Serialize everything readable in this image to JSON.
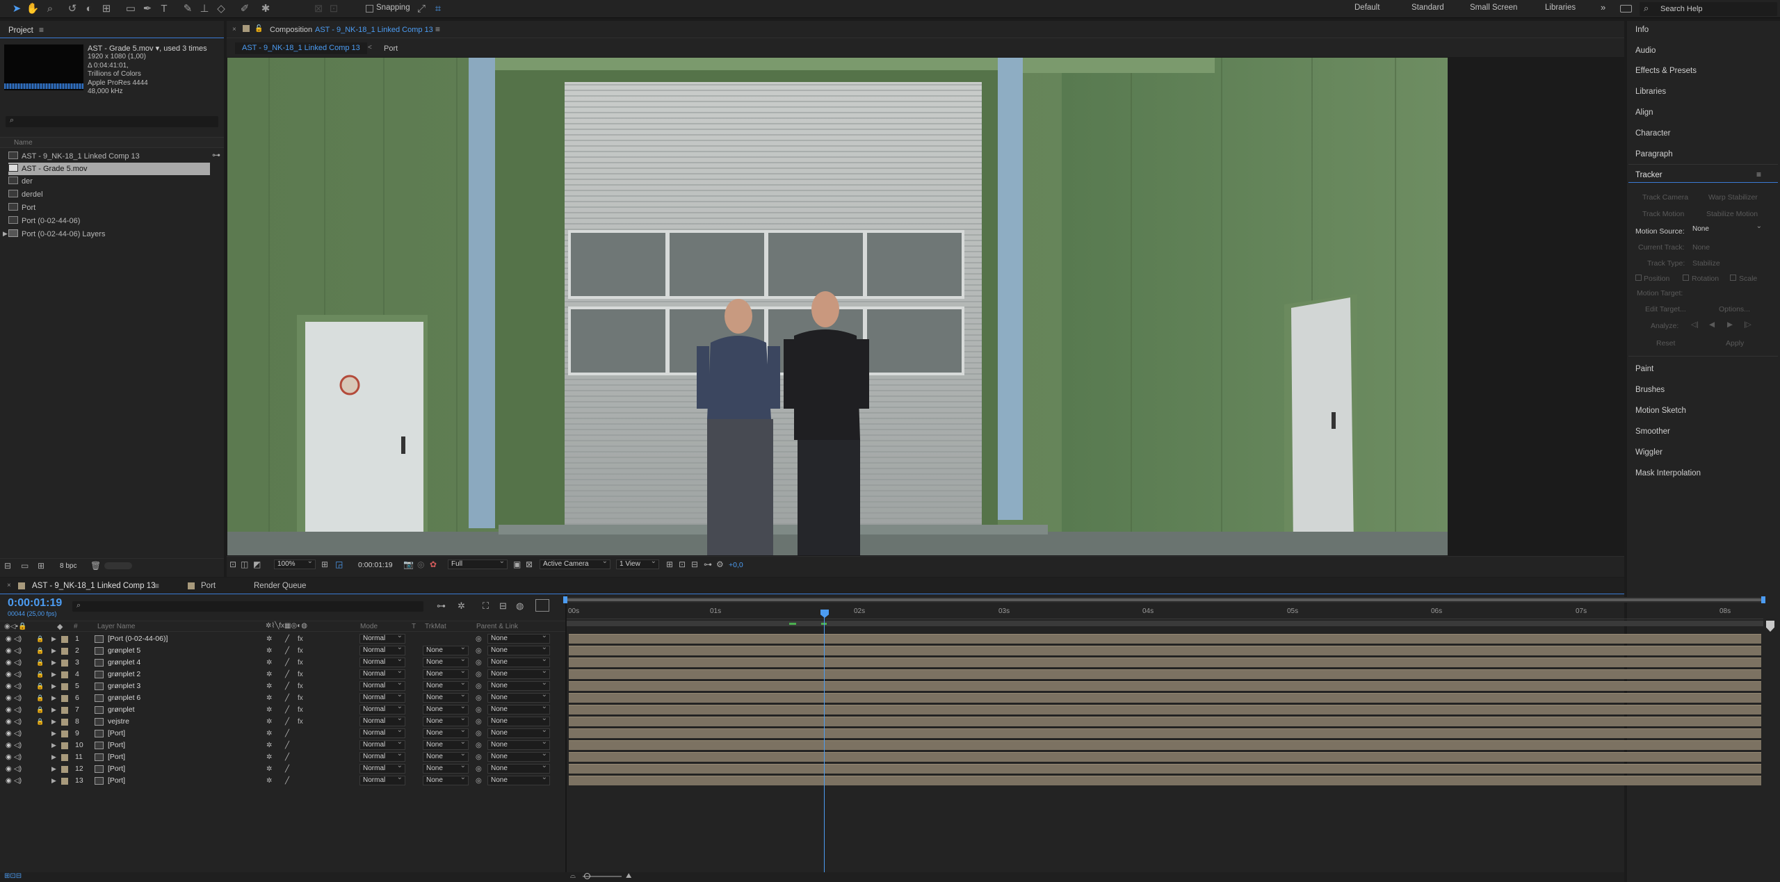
{
  "toolbar": {
    "snapping_label": "Snapping",
    "workspaces": [
      "Default",
      "Standard",
      "Small Screen",
      "Libraries"
    ],
    "more_label": "»",
    "search_placeholder": "Search Help"
  },
  "project": {
    "title": "Project",
    "selected_name": "AST - Grade 5.mov ▾",
    "used": ", used 3 times",
    "meta": [
      "1920 x 1080 (1,00)",
      "Δ 0:04:41:01,",
      "Trillions of Colors",
      "Apple ProRes 4444",
      "48,000 kHz"
    ],
    "column_name": "Name",
    "items": [
      {
        "label": "AST - 9_NK-18_1 Linked Comp 13",
        "type": "comp"
      },
      {
        "label": "AST - Grade 5.mov",
        "type": "footage",
        "selected": true
      },
      {
        "label": "der",
        "type": "comp"
      },
      {
        "label": "derdel",
        "type": "comp"
      },
      {
        "label": "Port",
        "type": "comp"
      },
      {
        "label": "Port (0-02-44-06)",
        "type": "comp"
      },
      {
        "label": "Port (0-02-44-06) Layers",
        "type": "folder"
      }
    ],
    "bpc": "8 bpc"
  },
  "composition": {
    "panel_prefix": "Composition",
    "panel_name": "AST - 9_NK-18_1 Linked Comp 13",
    "breadcrumb": [
      "AST - 9_NK-18_1 Linked Comp 13",
      "Port"
    ],
    "zoom": "100%",
    "timecode": "0:00:01:19",
    "resolution": "Full",
    "camera": "Active Camera",
    "views": "1 View",
    "exposure": "+0,0"
  },
  "right_panel": {
    "items_top": [
      "Info",
      "Audio",
      "Effects & Presets",
      "Libraries",
      "Align",
      "Character",
      "Paragraph"
    ],
    "tracker": {
      "title": "Tracker",
      "track_camera": "Track Camera",
      "warp_stabilizer": "Warp Stabilizer",
      "track_motion": "Track Motion",
      "stabilize_motion": "Stabilize Motion",
      "motion_source_label": "Motion Source:",
      "motion_source_value": "None",
      "current_track_label": "Current Track:",
      "current_track_value": "None",
      "track_type_label": "Track Type:",
      "track_type_value": "Stabilize",
      "position": "Position",
      "rotation": "Rotation",
      "scale": "Scale",
      "motion_target_label": "Motion Target:",
      "edit_target": "Edit Target...",
      "options": "Options...",
      "analyze": "Analyze:",
      "reset": "Reset",
      "apply": "Apply"
    },
    "items_bottom": [
      "Paint",
      "Brushes",
      "Motion Sketch",
      "Smoother",
      "Wiggler",
      "Mask Interpolation"
    ]
  },
  "timeline": {
    "tabs": [
      "AST - 9_NK-18_1 Linked Comp 13",
      "Port",
      "Render Queue"
    ],
    "timecode": "0:00:01:19",
    "frame_info": "00044 (25,00 fps)",
    "columns": {
      "hash": "#",
      "layer_name": "Layer Name",
      "mode": "Mode",
      "t": "T",
      "trkmat": "TrkMat",
      "parent": "Parent & Link"
    },
    "ruler": [
      "00s",
      "01s",
      "02s",
      "03s",
      "04s",
      "05s",
      "06s",
      "07s",
      "08s"
    ],
    "layers": [
      {
        "num": "1",
        "name": "[Port (0-02-44-06)]",
        "mode": "Normal",
        "trkmat": "",
        "parent": "None",
        "locked": true,
        "fx": true
      },
      {
        "num": "2",
        "name": "grønplet 5",
        "mode": "Normal",
        "trkmat": "None",
        "parent": "None",
        "locked": true,
        "fx": true
      },
      {
        "num": "3",
        "name": "grønplet 4",
        "mode": "Normal",
        "trkmat": "None",
        "parent": "None",
        "locked": true,
        "fx": true
      },
      {
        "num": "4",
        "name": "grønplet 2",
        "mode": "Normal",
        "trkmat": "None",
        "parent": "None",
        "locked": true,
        "fx": true
      },
      {
        "num": "5",
        "name": "grønplet 3",
        "mode": "Normal",
        "trkmat": "None",
        "parent": "None",
        "locked": true,
        "fx": true
      },
      {
        "num": "6",
        "name": "grønplet 6",
        "mode": "Normal",
        "trkmat": "None",
        "parent": "None",
        "locked": true,
        "fx": true
      },
      {
        "num": "7",
        "name": "grønplet",
        "mode": "Normal",
        "trkmat": "None",
        "parent": "None",
        "locked": true,
        "fx": true
      },
      {
        "num": "8",
        "name": "vejstre",
        "mode": "Normal",
        "trkmat": "None",
        "parent": "None",
        "locked": true,
        "fx": true
      },
      {
        "num": "9",
        "name": "[Port]",
        "mode": "Normal",
        "trkmat": "None",
        "parent": "None",
        "locked": false,
        "fx": false
      },
      {
        "num": "10",
        "name": "[Port]",
        "mode": "Normal",
        "trkmat": "None",
        "parent": "None",
        "locked": false,
        "fx": false
      },
      {
        "num": "11",
        "name": "[Port]",
        "mode": "Normal",
        "trkmat": "None",
        "parent": "None",
        "locked": false,
        "fx": false
      },
      {
        "num": "12",
        "name": "[Port]",
        "mode": "Normal",
        "trkmat": "None",
        "parent": "None",
        "locked": false,
        "fx": false
      },
      {
        "num": "13",
        "name": "[Port]",
        "mode": "Normal",
        "trkmat": "None",
        "parent": "None",
        "locked": false,
        "fx": false
      }
    ]
  },
  "colors": {
    "accent": "#4c9cf2",
    "label_tan": "#a89a7c",
    "layer_bar": "#7c7262"
  }
}
